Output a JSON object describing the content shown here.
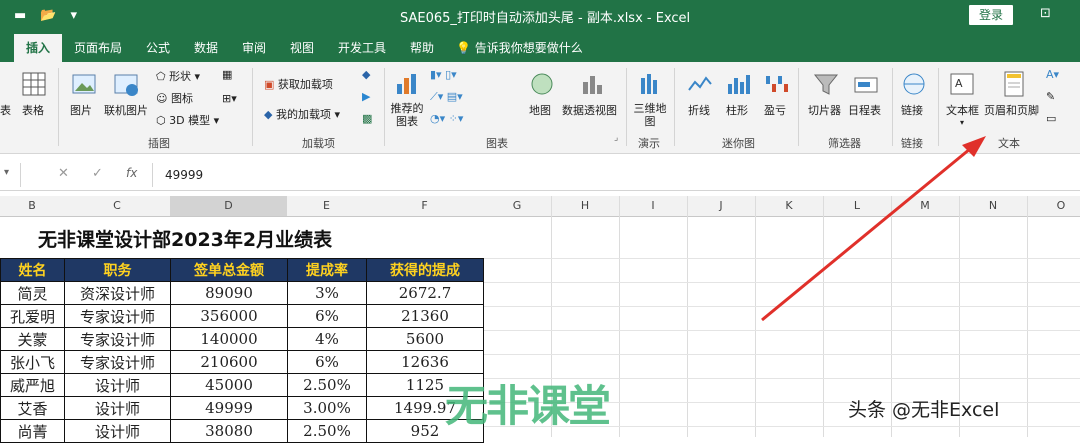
{
  "titlebar": {
    "title": "SAE065_打印时自动添加头尾 - 副本.xlsx  -  Excel",
    "login": "登录"
  },
  "tabs": [
    "插入",
    "页面布局",
    "公式",
    "数据",
    "审阅",
    "视图",
    "开发工具",
    "帮助",
    "告诉我你想要做什么"
  ],
  "ribbon": {
    "table": "表格",
    "tables_left": "表",
    "picture": "图片",
    "online_picture": "联机图片",
    "shapes": "形状",
    "icons": "图标",
    "model3d": "3D 模型",
    "group_illustrations": "插图",
    "get_addins": "获取加载项",
    "my_addins": "我的加载项",
    "group_addins": "加载项",
    "recommended_charts": "推荐的图表",
    "map": "地图",
    "pivotchart": "数据透视图",
    "group_charts": "图表",
    "map3d": "三维地图",
    "group_tours": "演示",
    "line": "折线",
    "column": "柱形",
    "winloss": "盈亏",
    "group_sparklines": "迷你图",
    "slicer": "切片器",
    "timeline": "日程表",
    "group_filters": "筛选器",
    "link": "链接",
    "group_links": "链接",
    "textbox": "文本框",
    "header_footer": "页眉和页脚",
    "group_text": "文本"
  },
  "formula_bar": {
    "fx": "fx",
    "value": "49999"
  },
  "columns": [
    "B",
    "C",
    "D",
    "E",
    "F",
    "G",
    "H",
    "I",
    "J",
    "K",
    "L",
    "M",
    "N",
    "O"
  ],
  "sheet": {
    "title": "无非课堂设计部2023年2月业绩表",
    "headers": [
      "姓名",
      "职务",
      "签单总金额",
      "提成率",
      "获得的提成"
    ],
    "rows": [
      [
        "简灵",
        "资深设计师",
        "89090",
        "3%",
        "2672.7"
      ],
      [
        "孔爱明",
        "专家设计师",
        "356000",
        "6%",
        "21360"
      ],
      [
        "关蒙",
        "专家设计师",
        "140000",
        "4%",
        "5600"
      ],
      [
        "张小飞",
        "专家设计师",
        "210600",
        "6%",
        "12636"
      ],
      [
        "威严旭",
        "设计师",
        "45000",
        "2.50%",
        "1125"
      ],
      [
        "艾香",
        "设计师",
        "49999",
        "3.00%",
        "1499.97"
      ],
      [
        "尚菁",
        "设计师",
        "38080",
        "2.50%",
        "952"
      ]
    ]
  },
  "watermark": "无非课堂",
  "credit": "头条 @无非Excel",
  "colors": {
    "excel_green": "#217346",
    "header_bg": "#1f3864",
    "header_text": "#ffd21f",
    "arrow": "#e0302a"
  }
}
